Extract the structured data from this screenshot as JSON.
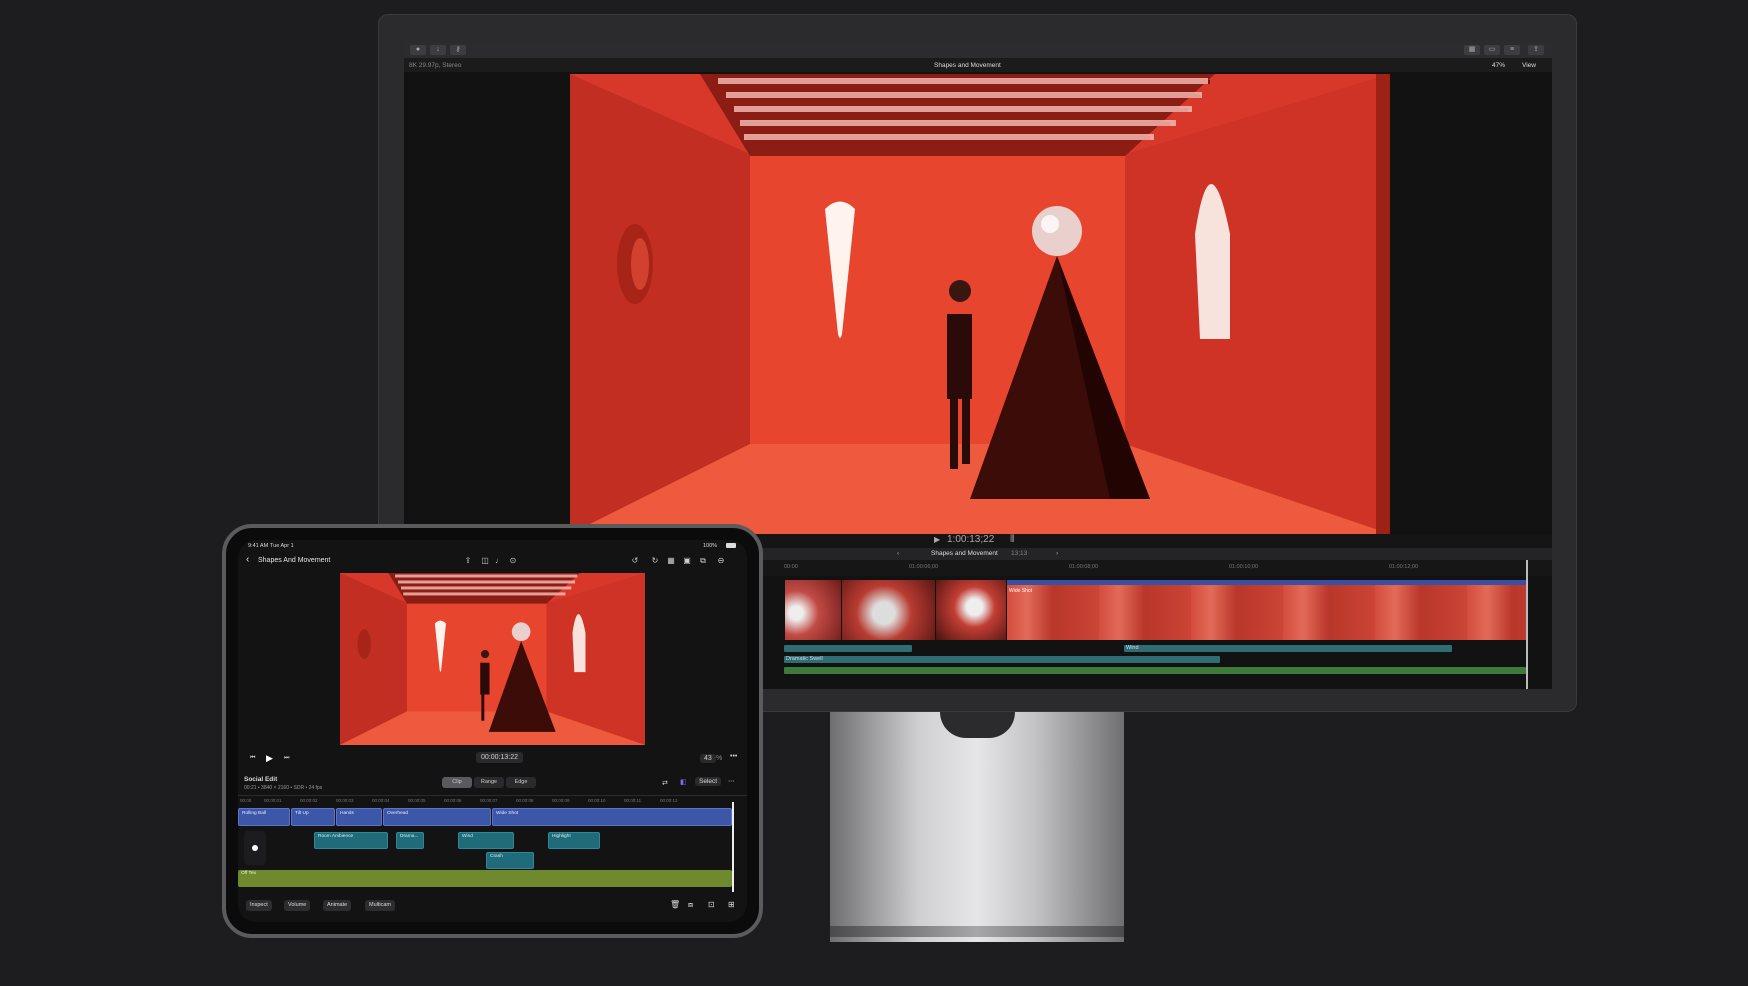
{
  "desktop": {
    "toolbar": {
      "left_icons": [
        "record-icon",
        "import-icon",
        "key-icon"
      ],
      "right_icons": [
        "grid-icon",
        "filmstrip-icon",
        "sliders-icon",
        "share-icon"
      ]
    },
    "infobar": {
      "format": "8K 29.97p, Stereo",
      "project_title": "Shapes and Movement",
      "zoom": "47%",
      "view_label": "View"
    },
    "playback": {
      "timecode": "1:00:13;22"
    },
    "timeline": {
      "project_name": "Shapes and Movement",
      "duration": "13;13",
      "ruler_ticks": [
        "00:00",
        "01:00:06;00",
        "01:00:08;00",
        "01:00:10;00",
        "01:00:12;00"
      ],
      "clip_label": "Wide Shot"
    },
    "audio_lanes": [
      {
        "label": "",
        "color": "#2f6d72"
      },
      {
        "label": "Wind",
        "color": "#2f6d72"
      },
      {
        "label": "Dramatic Swell",
        "color": "#2f6d72"
      },
      {
        "label": "",
        "color": "#3e7a3a"
      }
    ]
  },
  "ipad": {
    "status": {
      "time": "9:41 AM",
      "date": "Tue Apr 1",
      "battery": "100%"
    },
    "nav": {
      "title": "Shapes And Movement"
    },
    "controls": {
      "timecode": "00:00:13:22",
      "zoom": "43",
      "zoom_unit": "%"
    },
    "timeline": {
      "name": "Social Edit",
      "meta": "00:21 • 3840 × 2160 • SDR • 24 fps",
      "segments": [
        "Clip",
        "Range",
        "Edge"
      ],
      "select_label": "Select",
      "ruler_ticks": [
        "00:00",
        "00:00:01",
        "00:00:02",
        "00:00:03",
        "00:00:04",
        "00:00:05",
        "00:00:06",
        "00:00:07",
        "00:00:08",
        "00:00:09",
        "00:00:10",
        "00:00:11",
        "00:00:12"
      ],
      "video_clips": [
        "Rolling Ball",
        "Tilt Up",
        "Hands",
        "Overhead",
        "Wide Shot"
      ],
      "audio_clips": [
        "Room Ambience",
        "Drama...",
        "Wind",
        "Highlight",
        "Crash"
      ],
      "music_clip": "Off Tex"
    },
    "bottom": {
      "buttons": [
        "Inspect",
        "Volume",
        "Animate",
        "Multicam"
      ]
    }
  },
  "colors": {
    "stage_red": "#e03b2a",
    "clip_blue": "#3c56a8",
    "audio_teal": "#1f6b7a",
    "music_green": "#6f8a2e",
    "accent_purple": "#7b6cf0"
  }
}
